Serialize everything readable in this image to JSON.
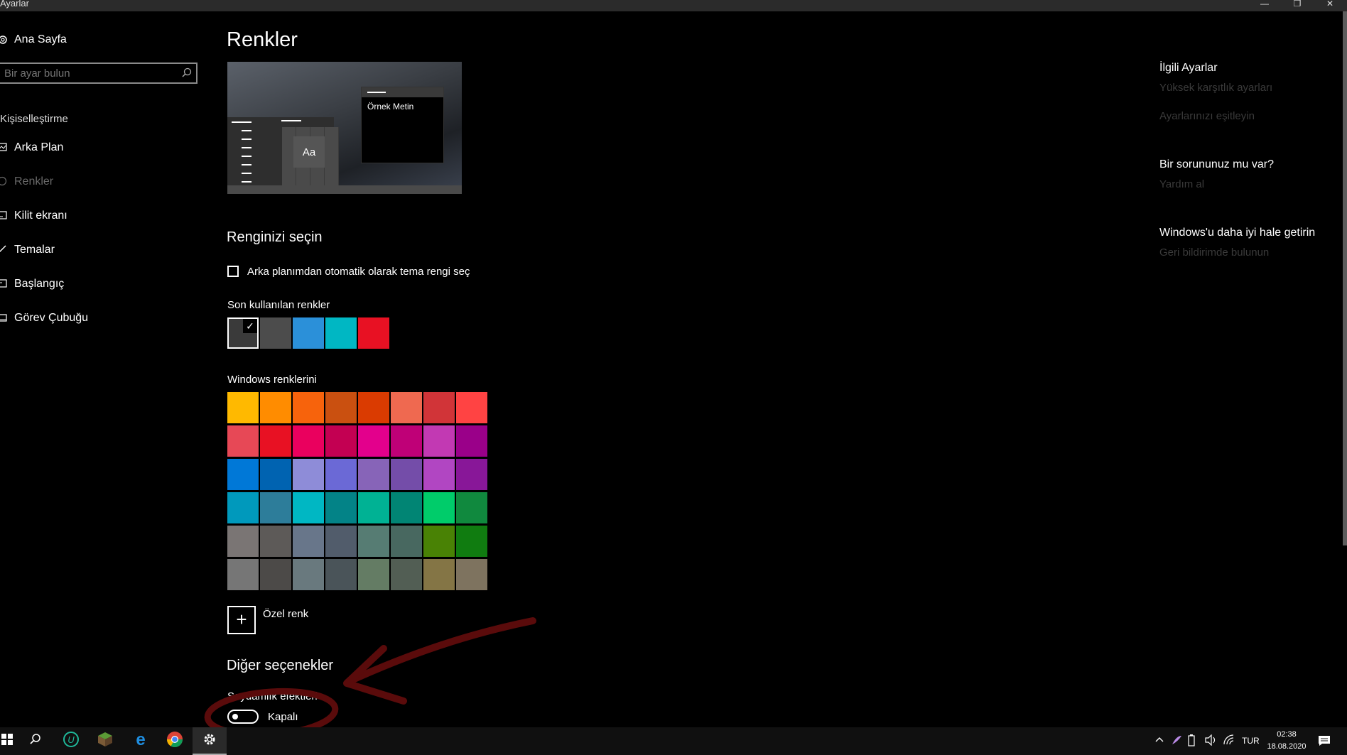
{
  "window": {
    "title": "Ayarlar"
  },
  "sidebar": {
    "home_label": "Ana Sayfa",
    "search_placeholder": "Bir ayar bulun",
    "section_title": "Kişiselleştirme",
    "items": [
      {
        "label": "Arka Plan",
        "icon": "image-icon"
      },
      {
        "label": "Renkler",
        "icon": "palette-icon",
        "selected": true
      },
      {
        "label": "Kilit ekranı",
        "icon": "lock-screen-icon"
      },
      {
        "label": "Temalar",
        "icon": "brush-icon"
      },
      {
        "label": "Başlangıç",
        "icon": "start-icon"
      },
      {
        "label": "Görev Çubuğu",
        "icon": "taskbar-icon"
      }
    ]
  },
  "main": {
    "title": "Renkler",
    "preview": {
      "sample_text": "Örnek Metin",
      "tile_text": "Aa"
    },
    "choose_color_heading": "Renginizi seçin",
    "auto_color_checkbox_label": "Arka planımdan otomatik olarak tema rengi seç",
    "auto_color_checked": false,
    "recent_colors_label": "Son kullanılan renkler",
    "recent_colors": [
      "#3a3a3a",
      "#4c4c4c",
      "#2b90d9",
      "#00b7c3",
      "#e81123"
    ],
    "recent_selected_index": 0,
    "windows_colors_label": "Windows renklerini",
    "windows_colors": [
      [
        "#ffb900",
        "#ff8c00",
        "#f7630c",
        "#ca5010",
        "#da3b01",
        "#ef6950",
        "#d13438",
        "#ff4343"
      ],
      [
        "#e74856",
        "#e81123",
        "#ea005e",
        "#c30052",
        "#e3008c",
        "#bf0077",
        "#c239b3",
        "#9a0089"
      ],
      [
        "#0078d7",
        "#0063b1",
        "#8e8cd8",
        "#6b69d6",
        "#8764b8",
        "#744da9",
        "#b146c2",
        "#881798"
      ],
      [
        "#0099bc",
        "#2d7d9a",
        "#00b7c3",
        "#038387",
        "#00b294",
        "#018574",
        "#00cc6a",
        "#10893e"
      ],
      [
        "#7a7574",
        "#5d5a58",
        "#68768a",
        "#515c6b",
        "#567c73",
        "#486860",
        "#498205",
        "#107c10"
      ],
      [
        "#767676",
        "#4c4a48",
        "#69797e",
        "#4a5459",
        "#647c64",
        "#525e54",
        "#847545",
        "#7e735f"
      ]
    ],
    "custom_color_label": "Özel renk",
    "other_options_heading": "Diğer seçenekler",
    "transparency_label": "Saydamlık efektleri",
    "transparency_state": "Kapalı"
  },
  "related": {
    "heading1": "İlgili Ayarlar",
    "link1": "Yüksek karşıtlık ayarları",
    "link2": "Ayarlarınızı eşitleyin",
    "heading2": "Bir sorununuz mu var?",
    "link3": "Yardım al",
    "heading3": "Windows'u daha iyi hale getirin",
    "link4": "Geri bildirimde bulunun"
  },
  "taskbar": {
    "language": "TUR",
    "time": "02:38",
    "date": "18.08.2020"
  }
}
